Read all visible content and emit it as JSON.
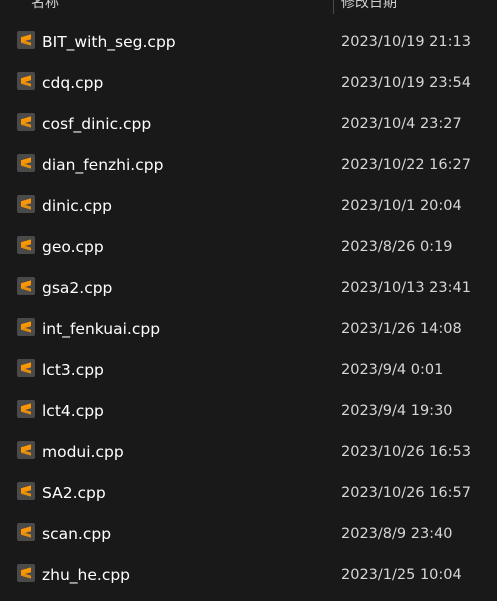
{
  "header": {
    "name_label": "名称",
    "date_label": "修改日期"
  },
  "icon": {
    "name": "sublime-text-file-icon",
    "accent": "#ff9800",
    "background": "#4a4a4a"
  },
  "files": [
    {
      "name": "BIT_with_seg.cpp",
      "date": "2023/10/19 21:13"
    },
    {
      "name": "cdq.cpp",
      "date": "2023/10/19 23:54"
    },
    {
      "name": "cosf_dinic.cpp",
      "date": "2023/10/4 23:27"
    },
    {
      "name": "dian_fenzhi.cpp",
      "date": "2023/10/22 16:27"
    },
    {
      "name": "dinic.cpp",
      "date": "2023/10/1 20:04"
    },
    {
      "name": "geo.cpp",
      "date": "2023/8/26 0:19"
    },
    {
      "name": "gsa2.cpp",
      "date": "2023/10/13 23:41"
    },
    {
      "name": "int_fenkuai.cpp",
      "date": "2023/1/26 14:08"
    },
    {
      "name": "lct3.cpp",
      "date": "2023/9/4 0:01"
    },
    {
      "name": "lct4.cpp",
      "date": "2023/9/4 19:30"
    },
    {
      "name": "modui.cpp",
      "date": "2023/10/26 16:53"
    },
    {
      "name": "SA2.cpp",
      "date": "2023/10/26 16:57"
    },
    {
      "name": "scan.cpp",
      "date": "2023/8/9 23:40"
    },
    {
      "name": "zhu_he.cpp",
      "date": "2023/1/25 10:04"
    }
  ]
}
